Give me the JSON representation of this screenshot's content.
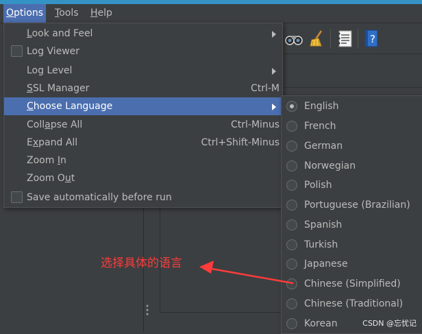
{
  "menubar": {
    "items": [
      {
        "mnemonic": "O",
        "rest": "ptions"
      },
      {
        "mnemonic": "T",
        "rest": "ools"
      },
      {
        "mnemonic": "H",
        "rest": "elp"
      }
    ]
  },
  "toolbar": {
    "icons": [
      "binoculars-icon",
      "broom-icon",
      "notepad-icon",
      "help-book-icon"
    ]
  },
  "options_menu": {
    "items": [
      {
        "pre": "",
        "mnemonic": "L",
        "post": "ook and Feel",
        "shortcut": "",
        "submenu": true
      },
      {
        "label": "Log Viewer",
        "checkbox": true,
        "checked": false
      },
      {
        "label": "Log Level",
        "submenu": true
      },
      {
        "pre": "",
        "mnemonic": "S",
        "post": "SL Manager",
        "shortcut": "Ctrl-M"
      },
      {
        "pre": "",
        "mnemonic": "C",
        "post": "hoose Language",
        "submenu": true,
        "selected": true
      },
      {
        "pre": "Coll",
        "mnemonic": "a",
        "post": "pse All",
        "shortcut": "Ctrl-Minus"
      },
      {
        "pre": "E",
        "mnemonic": "x",
        "post": "pand All",
        "shortcut": "Ctrl+Shift-Minus"
      },
      {
        "pre": "Zoom ",
        "mnemonic": "I",
        "post": "n",
        "shortcut": ""
      },
      {
        "pre": "Zoom O",
        "mnemonic": "u",
        "post": "t",
        "shortcut": ""
      },
      {
        "label": "Save automatically before run",
        "checkbox": true,
        "checked": false
      }
    ]
  },
  "language_menu": {
    "selected": "English",
    "items": [
      "English",
      "French",
      "German",
      "Norwegian",
      "Polish",
      "Portuguese (Brazilian)",
      "Spanish",
      "Turkish",
      "Japanese",
      "Chinese (Simplified)",
      "Chinese (Traditional)",
      "Korean"
    ]
  },
  "annotation": {
    "text": "选择具体的语言",
    "color": "#ff3b3b"
  },
  "watermark": "CSDN @忘忧记",
  "colors": {
    "accent": "#3592c4",
    "selection": "#4b6eaf",
    "background": "#3c3f41"
  }
}
